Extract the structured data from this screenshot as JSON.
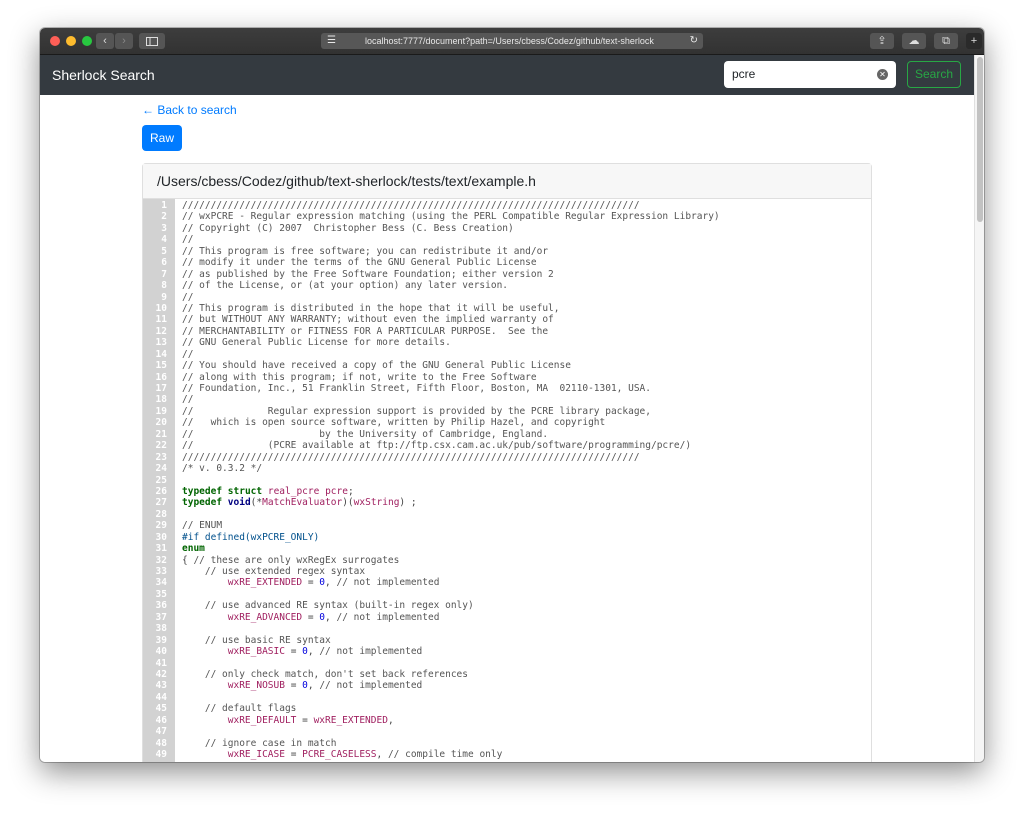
{
  "browser": {
    "url": "localhost:7777/document?path=/Users/cbess/Codez/github/text-sherlock"
  },
  "navbar": {
    "brand": "Sherlock Search",
    "search_value": "pcre",
    "search_button": "Search"
  },
  "page": {
    "back_link": "Back to search",
    "raw_button": "Raw",
    "file_path": "/Users/cbess/Codez/github/text-sherlock/tests/text/example.h"
  },
  "colors": {
    "navbar": "#343a40",
    "primary": "#007bff",
    "success": "#28a745"
  },
  "code_lines": [
    {
      "n": "1",
      "t": "////////////////////////////////////////////////////////////////////////////////"
    },
    {
      "n": "2",
      "t": "// wxPCRE - Regular expression matching (using the PERL Compatible Regular Expression Library)"
    },
    {
      "n": "3",
      "t": "// Copyright (C) 2007  Christopher Bess (C. Bess Creation)"
    },
    {
      "n": "4",
      "t": "//"
    },
    {
      "n": "5",
      "t": "// This program is free software; you can redistribute it and/or"
    },
    {
      "n": "6",
      "t": "// modify it under the terms of the GNU General Public License"
    },
    {
      "n": "7",
      "t": "// as published by the Free Software Foundation; either version 2"
    },
    {
      "n": "8",
      "t": "// of the License, or (at your option) any later version."
    },
    {
      "n": "9",
      "t": "//"
    },
    {
      "n": "10",
      "t": "// This program is distributed in the hope that it will be useful,"
    },
    {
      "n": "11",
      "t": "// but WITHOUT ANY WARRANTY; without even the implied warranty of"
    },
    {
      "n": "12",
      "t": "// MERCHANTABILITY or FITNESS FOR A PARTICULAR PURPOSE.  See the"
    },
    {
      "n": "13",
      "t": "// GNU General Public License for more details."
    },
    {
      "n": "14",
      "t": "//"
    },
    {
      "n": "15",
      "t": "// You should have received a copy of the GNU General Public License"
    },
    {
      "n": "16",
      "t": "// along with this program; if not, write to the Free Software"
    },
    {
      "n": "17",
      "t": "// Foundation, Inc., 51 Franklin Street, Fifth Floor, Boston, MA  02110-1301, USA."
    },
    {
      "n": "18",
      "t": "//"
    },
    {
      "n": "19",
      "t": "//             Regular expression support is provided by the PCRE library package,"
    },
    {
      "n": "20",
      "t": "//   which is open source software, written by Philip Hazel, and copyright"
    },
    {
      "n": "21",
      "t": "//                      by the University of Cambridge, England."
    },
    {
      "n": "22",
      "t": "//             (PCRE available at ftp://ftp.csx.cam.ac.uk/pub/software/programming/pcre/)"
    },
    {
      "n": "23",
      "t": "////////////////////////////////////////////////////////////////////////////////"
    },
    {
      "n": "24",
      "t": "/* v. 0.3.2 */"
    },
    {
      "n": "25",
      "t": ""
    },
    {
      "n": "26",
      "t": "typedef struct real_pcre pcre;"
    },
    {
      "n": "27",
      "t": "typedef void(*MatchEvaluator)(wxString) ;"
    },
    {
      "n": "28",
      "t": ""
    },
    {
      "n": "29",
      "t": "// ENUM"
    },
    {
      "n": "30",
      "t": "#if defined(wxPCRE_ONLY)"
    },
    {
      "n": "31",
      "t": "enum"
    },
    {
      "n": "32",
      "t": "{ // these are only wxRegEx surrogates"
    },
    {
      "n": "33",
      "t": "    // use extended regex syntax"
    },
    {
      "n": "34",
      "t": "        wxRE_EXTENDED = 0, // not implemented"
    },
    {
      "n": "35",
      "t": ""
    },
    {
      "n": "36",
      "t": "    // use advanced RE syntax (built-in regex only)"
    },
    {
      "n": "37",
      "t": "        wxRE_ADVANCED = 0, // not implemented"
    },
    {
      "n": "38",
      "t": ""
    },
    {
      "n": "39",
      "t": "    // use basic RE syntax"
    },
    {
      "n": "40",
      "t": "        wxRE_BASIC = 0, // not implemented"
    },
    {
      "n": "41",
      "t": ""
    },
    {
      "n": "42",
      "t": "    // only check match, don't set back references"
    },
    {
      "n": "43",
      "t": "        wxRE_NOSUB = 0, // not implemented"
    },
    {
      "n": "44",
      "t": ""
    },
    {
      "n": "45",
      "t": "    // default flags"
    },
    {
      "n": "46",
      "t": "        wxRE_DEFAULT = wxRE_EXTENDED,"
    },
    {
      "n": "47",
      "t": ""
    },
    {
      "n": "48",
      "t": "    // ignore case in match"
    },
    {
      "n": "49",
      "t": "        wxRE_ICASE = PCRE_CASELESS, // compile time only"
    }
  ]
}
